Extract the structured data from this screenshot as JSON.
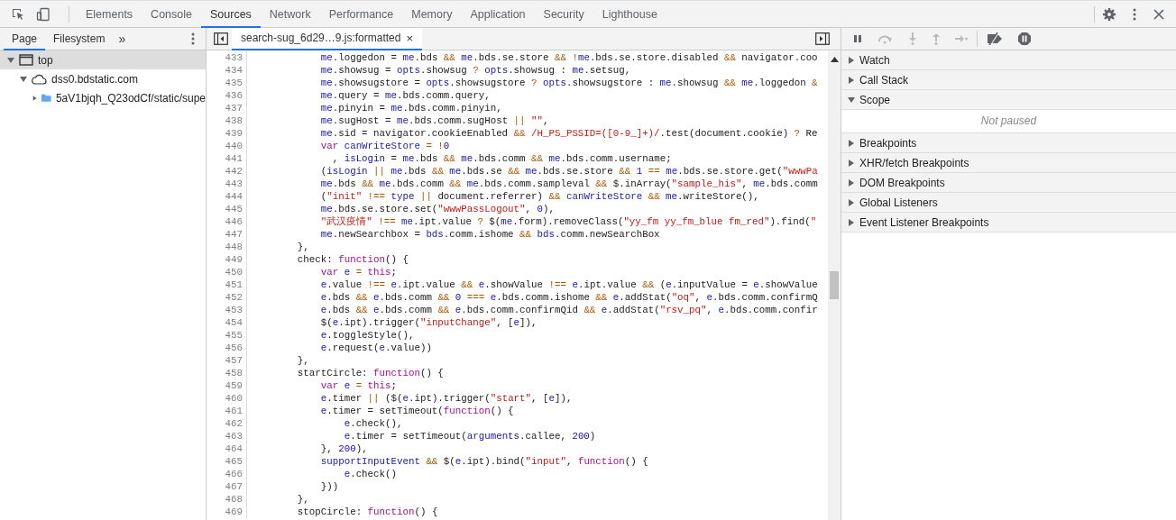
{
  "top_tabs": [
    {
      "label": "Elements",
      "selected": false
    },
    {
      "label": "Console",
      "selected": false
    },
    {
      "label": "Sources",
      "selected": true
    },
    {
      "label": "Network",
      "selected": false
    },
    {
      "label": "Performance",
      "selected": false
    },
    {
      "label": "Memory",
      "selected": false
    },
    {
      "label": "Application",
      "selected": false
    },
    {
      "label": "Security",
      "selected": false
    },
    {
      "label": "Lighthouse",
      "selected": false
    }
  ],
  "navigator": {
    "tabs": [
      {
        "label": "Page",
        "selected": true
      },
      {
        "label": "Filesystem",
        "selected": false
      }
    ],
    "more": "»",
    "tree": [
      {
        "kind": "frame",
        "label": "top",
        "expanded": true,
        "selected": true,
        "children": [
          {
            "kind": "domain",
            "label": "dss0.bdstatic.com",
            "expanded": true,
            "selected": false,
            "children": [
              {
                "kind": "folder",
                "label": "5aV1bjqh_Q23odCf/static/supe",
                "expanded": false,
                "selected": false
              }
            ]
          }
        ]
      }
    ]
  },
  "editor": {
    "file_tab": {
      "label": "search-sug_6d29…9.js:formatted",
      "close": "×"
    },
    "lines": [
      {
        "number": "433",
        "tokens": [
          {
            "kind": "var",
            "text": "            me"
          },
          {
            "kind": "plain",
            "text": ".loggedon = "
          },
          {
            "kind": "var",
            "text": "me"
          },
          {
            "kind": "plain",
            "text": ".bds "
          },
          {
            "kind": "op",
            "text": "&&"
          },
          {
            "kind": "var",
            "text": " me"
          },
          {
            "kind": "plain",
            "text": ".bds.se.store "
          },
          {
            "kind": "op",
            "text": "&& !"
          },
          {
            "kind": "var",
            "text": "me"
          },
          {
            "kind": "plain",
            "text": ".bds.se.store.disabled "
          },
          {
            "kind": "op",
            "text": "&&"
          },
          {
            "kind": "plain",
            "text": " navigator.coo"
          }
        ]
      },
      {
        "number": "434",
        "tokens": [
          {
            "kind": "var",
            "text": "            me"
          },
          {
            "kind": "plain",
            "text": ".showsug = "
          },
          {
            "kind": "var",
            "text": "opts"
          },
          {
            "kind": "plain",
            "text": ".showsug "
          },
          {
            "kind": "op",
            "text": "?"
          },
          {
            "kind": "var",
            "text": " opts"
          },
          {
            "kind": "plain",
            "text": ".showsug : "
          },
          {
            "kind": "var",
            "text": "me"
          },
          {
            "kind": "plain",
            "text": ".setsug,"
          }
        ]
      },
      {
        "number": "435",
        "tokens": [
          {
            "kind": "var",
            "text": "            me"
          },
          {
            "kind": "plain",
            "text": ".showsugstore = "
          },
          {
            "kind": "var",
            "text": "opts"
          },
          {
            "kind": "plain",
            "text": ".showsugstore "
          },
          {
            "kind": "op",
            "text": "?"
          },
          {
            "kind": "var",
            "text": " opts"
          },
          {
            "kind": "plain",
            "text": ".showsugstore : "
          },
          {
            "kind": "var",
            "text": "me"
          },
          {
            "kind": "plain",
            "text": ".showsug "
          },
          {
            "kind": "op",
            "text": "&&"
          },
          {
            "kind": "var",
            "text": " me"
          },
          {
            "kind": "plain",
            "text": ".loggedon "
          },
          {
            "kind": "op",
            "text": "&"
          }
        ]
      },
      {
        "number": "436",
        "tokens": [
          {
            "kind": "var",
            "text": "            me"
          },
          {
            "kind": "plain",
            "text": ".query = "
          },
          {
            "kind": "var",
            "text": "me"
          },
          {
            "kind": "plain",
            "text": ".bds.comm.query,"
          }
        ]
      },
      {
        "number": "437",
        "tokens": [
          {
            "kind": "var",
            "text": "            me"
          },
          {
            "kind": "plain",
            "text": ".pinyin = "
          },
          {
            "kind": "var",
            "text": "me"
          },
          {
            "kind": "plain",
            "text": ".bds.comm.pinyin,"
          }
        ]
      },
      {
        "number": "438",
        "tokens": [
          {
            "kind": "var",
            "text": "            me"
          },
          {
            "kind": "plain",
            "text": ".sugHost = "
          },
          {
            "kind": "var",
            "text": "me"
          },
          {
            "kind": "plain",
            "text": ".bds.comm.sugHost "
          },
          {
            "kind": "op",
            "text": "||"
          },
          {
            "kind": "str",
            "text": " \"\""
          },
          {
            "kind": "plain",
            "text": ","
          }
        ]
      },
      {
        "number": "439",
        "tokens": [
          {
            "kind": "var",
            "text": "            me"
          },
          {
            "kind": "plain",
            "text": ".sid = navigator.cookieEnabled "
          },
          {
            "kind": "op",
            "text": "&&"
          },
          {
            "kind": "re",
            "text": " /H_PS_PSSID=([0-9_]+)/"
          },
          {
            "kind": "plain",
            "text": ".test(document.cookie) "
          },
          {
            "kind": "op",
            "text": "?"
          },
          {
            "kind": "plain",
            "text": " Re"
          }
        ]
      },
      {
        "number": "440",
        "tokens": [
          {
            "kind": "kw",
            "text": "            var"
          },
          {
            "kind": "var",
            "text": " canWriteStore"
          },
          {
            "kind": "op",
            "text": " = !"
          },
          {
            "kind": "num",
            "text": "0"
          }
        ]
      },
      {
        "number": "441",
        "tokens": [
          {
            "kind": "plain",
            "text": "              , "
          },
          {
            "kind": "var",
            "text": "isLogin"
          },
          {
            "kind": "plain",
            "text": " = "
          },
          {
            "kind": "var",
            "text": "me"
          },
          {
            "kind": "plain",
            "text": ".bds "
          },
          {
            "kind": "op",
            "text": "&&"
          },
          {
            "kind": "var",
            "text": " me"
          },
          {
            "kind": "plain",
            "text": ".bds.comm "
          },
          {
            "kind": "op",
            "text": "&&"
          },
          {
            "kind": "var",
            "text": " me"
          },
          {
            "kind": "plain",
            "text": ".bds.comm.username;"
          }
        ]
      },
      {
        "number": "442",
        "tokens": [
          {
            "kind": "plain",
            "text": "            ("
          },
          {
            "kind": "var",
            "text": "isLogin"
          },
          {
            "kind": "op",
            "text": " ||"
          },
          {
            "kind": "var",
            "text": " me"
          },
          {
            "kind": "plain",
            "text": ".bds "
          },
          {
            "kind": "op",
            "text": "&&"
          },
          {
            "kind": "var",
            "text": " me"
          },
          {
            "kind": "plain",
            "text": ".bds.se "
          },
          {
            "kind": "op",
            "text": "&&"
          },
          {
            "kind": "var",
            "text": " me"
          },
          {
            "kind": "plain",
            "text": ".bds.se.store "
          },
          {
            "kind": "op",
            "text": "&&"
          },
          {
            "kind": "num",
            "text": " 1"
          },
          {
            "kind": "op",
            "text": " =="
          },
          {
            "kind": "var",
            "text": " me"
          },
          {
            "kind": "plain",
            "text": ".bds.se.store.get("
          },
          {
            "kind": "str",
            "text": "\"wwwPa"
          }
        ]
      },
      {
        "number": "443",
        "tokens": [
          {
            "kind": "var",
            "text": "            me"
          },
          {
            "kind": "plain",
            "text": ".bds "
          },
          {
            "kind": "op",
            "text": "&&"
          },
          {
            "kind": "var",
            "text": " me"
          },
          {
            "kind": "plain",
            "text": ".bds.comm "
          },
          {
            "kind": "op",
            "text": "&&"
          },
          {
            "kind": "var",
            "text": " me"
          },
          {
            "kind": "plain",
            "text": ".bds.comm.sampleval "
          },
          {
            "kind": "op",
            "text": "&&"
          },
          {
            "kind": "plain",
            "text": " $.inArray("
          },
          {
            "kind": "str",
            "text": "\"sample_his\""
          },
          {
            "kind": "plain",
            "text": ", "
          },
          {
            "kind": "var",
            "text": "me"
          },
          {
            "kind": "plain",
            "text": ".bds.comm"
          }
        ]
      },
      {
        "number": "444",
        "tokens": [
          {
            "kind": "plain",
            "text": "            ("
          },
          {
            "kind": "str",
            "text": "\"init\""
          },
          {
            "kind": "op",
            "text": " !=="
          },
          {
            "kind": "var",
            "text": " type"
          },
          {
            "kind": "op",
            "text": " ||"
          },
          {
            "kind": "plain",
            "text": " document.referrer) "
          },
          {
            "kind": "op",
            "text": "&&"
          },
          {
            "kind": "var",
            "text": " canWriteStore"
          },
          {
            "kind": "op",
            "text": " &&"
          },
          {
            "kind": "var",
            "text": " me"
          },
          {
            "kind": "plain",
            "text": ".writeStore(),"
          }
        ]
      },
      {
        "number": "445",
        "tokens": [
          {
            "kind": "var",
            "text": "            me"
          },
          {
            "kind": "plain",
            "text": ".bds.se.store.set("
          },
          {
            "kind": "str",
            "text": "\"wwwPassLogout\""
          },
          {
            "kind": "plain",
            "text": ", "
          },
          {
            "kind": "num",
            "text": "0"
          },
          {
            "kind": "plain",
            "text": "),"
          }
        ]
      },
      {
        "number": "446",
        "tokens": [
          {
            "kind": "str",
            "text": "            \"武汉疫情\""
          },
          {
            "kind": "op",
            "text": " !=="
          },
          {
            "kind": "var",
            "text": " me"
          },
          {
            "kind": "plain",
            "text": ".ipt.value "
          },
          {
            "kind": "op",
            "text": "?"
          },
          {
            "kind": "plain",
            "text": " $("
          },
          {
            "kind": "var",
            "text": "me"
          },
          {
            "kind": "plain",
            "text": ".form).removeClass("
          },
          {
            "kind": "str",
            "text": "\"yy_fm yy_fm_blue fm_red\""
          },
          {
            "kind": "plain",
            "text": ").find("
          },
          {
            "kind": "str",
            "text": "\""
          }
        ]
      },
      {
        "number": "447",
        "tokens": [
          {
            "kind": "var",
            "text": "            me"
          },
          {
            "kind": "plain",
            "text": ".newSearchbox = "
          },
          {
            "kind": "var",
            "text": "bds"
          },
          {
            "kind": "plain",
            "text": ".comm.ishome "
          },
          {
            "kind": "op",
            "text": "&&"
          },
          {
            "kind": "var",
            "text": " bds"
          },
          {
            "kind": "plain",
            "text": ".comm.newSearchBox"
          }
        ]
      },
      {
        "number": "448",
        "tokens": [
          {
            "kind": "plain",
            "text": "        },"
          }
        ]
      },
      {
        "number": "449",
        "tokens": [
          {
            "kind": "plain",
            "text": "        check: "
          },
          {
            "kind": "kw",
            "text": "function"
          },
          {
            "kind": "plain",
            "text": "() {"
          }
        ]
      },
      {
        "number": "450",
        "tokens": [
          {
            "kind": "kw",
            "text": "            var"
          },
          {
            "kind": "var",
            "text": " e"
          },
          {
            "kind": "op",
            "text": " ="
          },
          {
            "kind": "kw",
            "text": " this"
          },
          {
            "kind": "plain",
            "text": ";"
          }
        ]
      },
      {
        "number": "451",
        "tokens": [
          {
            "kind": "var",
            "text": "            e"
          },
          {
            "kind": "plain",
            "text": ".value "
          },
          {
            "kind": "op",
            "text": "!=="
          },
          {
            "kind": "var",
            "text": " e"
          },
          {
            "kind": "plain",
            "text": ".ipt.value "
          },
          {
            "kind": "op",
            "text": "&&"
          },
          {
            "kind": "var",
            "text": " e"
          },
          {
            "kind": "plain",
            "text": ".showValue "
          },
          {
            "kind": "op",
            "text": "!=="
          },
          {
            "kind": "var",
            "text": " e"
          },
          {
            "kind": "plain",
            "text": ".ipt.value "
          },
          {
            "kind": "op",
            "text": "&&"
          },
          {
            "kind": "plain",
            "text": " ("
          },
          {
            "kind": "var",
            "text": "e"
          },
          {
            "kind": "plain",
            "text": ".inputValue = "
          },
          {
            "kind": "var",
            "text": "e"
          },
          {
            "kind": "plain",
            "text": ".showValue"
          }
        ]
      },
      {
        "number": "452",
        "tokens": [
          {
            "kind": "var",
            "text": "            e"
          },
          {
            "kind": "plain",
            "text": ".bds "
          },
          {
            "kind": "op",
            "text": "&&"
          },
          {
            "kind": "var",
            "text": " e"
          },
          {
            "kind": "plain",
            "text": ".bds.comm "
          },
          {
            "kind": "op",
            "text": "&&"
          },
          {
            "kind": "num",
            "text": " 0"
          },
          {
            "kind": "op",
            "text": " ==="
          },
          {
            "kind": "var",
            "text": " e"
          },
          {
            "kind": "plain",
            "text": ".bds.comm.ishome "
          },
          {
            "kind": "op",
            "text": "&&"
          },
          {
            "kind": "var",
            "text": " e"
          },
          {
            "kind": "plain",
            "text": ".addStat("
          },
          {
            "kind": "str",
            "text": "\"oq\""
          },
          {
            "kind": "plain",
            "text": ", "
          },
          {
            "kind": "var",
            "text": "e"
          },
          {
            "kind": "plain",
            "text": ".bds.comm.confirmQ"
          }
        ]
      },
      {
        "number": "453",
        "tokens": [
          {
            "kind": "var",
            "text": "            e"
          },
          {
            "kind": "plain",
            "text": ".bds "
          },
          {
            "kind": "op",
            "text": "&&"
          },
          {
            "kind": "var",
            "text": " e"
          },
          {
            "kind": "plain",
            "text": ".bds.comm "
          },
          {
            "kind": "op",
            "text": "&&"
          },
          {
            "kind": "var",
            "text": " e"
          },
          {
            "kind": "plain",
            "text": ".bds.comm.confirmQid "
          },
          {
            "kind": "op",
            "text": "&&"
          },
          {
            "kind": "var",
            "text": " e"
          },
          {
            "kind": "plain",
            "text": ".addStat("
          },
          {
            "kind": "str",
            "text": "\"rsv_pq\""
          },
          {
            "kind": "plain",
            "text": ", "
          },
          {
            "kind": "var",
            "text": "e"
          },
          {
            "kind": "plain",
            "text": ".bds.comm.confir"
          }
        ]
      },
      {
        "number": "454",
        "tokens": [
          {
            "kind": "plain",
            "text": "            $("
          },
          {
            "kind": "var",
            "text": "e"
          },
          {
            "kind": "plain",
            "text": ".ipt).trigger("
          },
          {
            "kind": "str",
            "text": "\"inputChange\""
          },
          {
            "kind": "plain",
            "text": ", ["
          },
          {
            "kind": "var",
            "text": "e"
          },
          {
            "kind": "plain",
            "text": "]),"
          }
        ]
      },
      {
        "number": "455",
        "tokens": [
          {
            "kind": "var",
            "text": "            e"
          },
          {
            "kind": "plain",
            "text": ".toggleStyle(),"
          }
        ]
      },
      {
        "number": "456",
        "tokens": [
          {
            "kind": "var",
            "text": "            e"
          },
          {
            "kind": "plain",
            "text": ".request("
          },
          {
            "kind": "var",
            "text": "e"
          },
          {
            "kind": "plain",
            "text": ".value))"
          }
        ]
      },
      {
        "number": "457",
        "tokens": [
          {
            "kind": "plain",
            "text": "        },"
          }
        ]
      },
      {
        "number": "458",
        "tokens": [
          {
            "kind": "plain",
            "text": "        startCircle: "
          },
          {
            "kind": "kw",
            "text": "function"
          },
          {
            "kind": "plain",
            "text": "() {"
          }
        ]
      },
      {
        "number": "459",
        "tokens": [
          {
            "kind": "kw",
            "text": "            var"
          },
          {
            "kind": "var",
            "text": " e"
          },
          {
            "kind": "op",
            "text": " ="
          },
          {
            "kind": "kw",
            "text": " this"
          },
          {
            "kind": "plain",
            "text": ";"
          }
        ]
      },
      {
        "number": "460",
        "tokens": [
          {
            "kind": "var",
            "text": "            e"
          },
          {
            "kind": "plain",
            "text": ".timer "
          },
          {
            "kind": "op",
            "text": "||"
          },
          {
            "kind": "plain",
            "text": " ($("
          },
          {
            "kind": "var",
            "text": "e"
          },
          {
            "kind": "plain",
            "text": ".ipt).trigger("
          },
          {
            "kind": "str",
            "text": "\"start\""
          },
          {
            "kind": "plain",
            "text": ", ["
          },
          {
            "kind": "var",
            "text": "e"
          },
          {
            "kind": "plain",
            "text": "]),"
          }
        ]
      },
      {
        "number": "461",
        "tokens": [
          {
            "kind": "var",
            "text": "            e"
          },
          {
            "kind": "plain",
            "text": ".timer = setTimeout("
          },
          {
            "kind": "kw",
            "text": "function"
          },
          {
            "kind": "plain",
            "text": "() {"
          }
        ]
      },
      {
        "number": "462",
        "tokens": [
          {
            "kind": "var",
            "text": "                e"
          },
          {
            "kind": "plain",
            "text": ".check(),"
          }
        ]
      },
      {
        "number": "463",
        "tokens": [
          {
            "kind": "var",
            "text": "                e"
          },
          {
            "kind": "plain",
            "text": ".timer = setTimeout("
          },
          {
            "kind": "var",
            "text": "arguments"
          },
          {
            "kind": "plain",
            "text": ".callee, "
          },
          {
            "kind": "num",
            "text": "200"
          },
          {
            "kind": "plain",
            "text": ")"
          }
        ]
      },
      {
        "number": "464",
        "tokens": [
          {
            "kind": "plain",
            "text": "            }, "
          },
          {
            "kind": "num",
            "text": "200"
          },
          {
            "kind": "plain",
            "text": "),"
          }
        ]
      },
      {
        "number": "465",
        "tokens": [
          {
            "kind": "var",
            "text": "            supportInputEvent"
          },
          {
            "kind": "op",
            "text": " &&"
          },
          {
            "kind": "plain",
            "text": " $("
          },
          {
            "kind": "var",
            "text": "e"
          },
          {
            "kind": "plain",
            "text": ".ipt).bind("
          },
          {
            "kind": "str",
            "text": "\"input\""
          },
          {
            "kind": "plain",
            "text": ", "
          },
          {
            "kind": "kw",
            "text": "function"
          },
          {
            "kind": "plain",
            "text": "() {"
          }
        ]
      },
      {
        "number": "466",
        "tokens": [
          {
            "kind": "var",
            "text": "                e"
          },
          {
            "kind": "plain",
            "text": ".check()"
          }
        ]
      },
      {
        "number": "467",
        "tokens": [
          {
            "kind": "plain",
            "text": "            }))"
          }
        ]
      },
      {
        "number": "468",
        "tokens": [
          {
            "kind": "plain",
            "text": "        },"
          }
        ]
      },
      {
        "number": "469",
        "tokens": [
          {
            "kind": "plain",
            "text": "        stopCircle: "
          },
          {
            "kind": "kw",
            "text": "function"
          },
          {
            "kind": "plain",
            "text": "() {"
          }
        ]
      }
    ]
  },
  "debugger": {
    "sections": [
      {
        "title": "Watch",
        "expanded": false
      },
      {
        "title": "Call Stack",
        "expanded": false
      },
      {
        "title": "Scope",
        "expanded": true,
        "message": "Not paused"
      },
      {
        "title": "Breakpoints",
        "expanded": false
      },
      {
        "title": "XHR/fetch Breakpoints",
        "expanded": false
      },
      {
        "title": "DOM Breakpoints",
        "expanded": false
      },
      {
        "title": "Global Listeners",
        "expanded": false
      },
      {
        "title": "Event Listener Breakpoints",
        "expanded": false
      }
    ]
  }
}
